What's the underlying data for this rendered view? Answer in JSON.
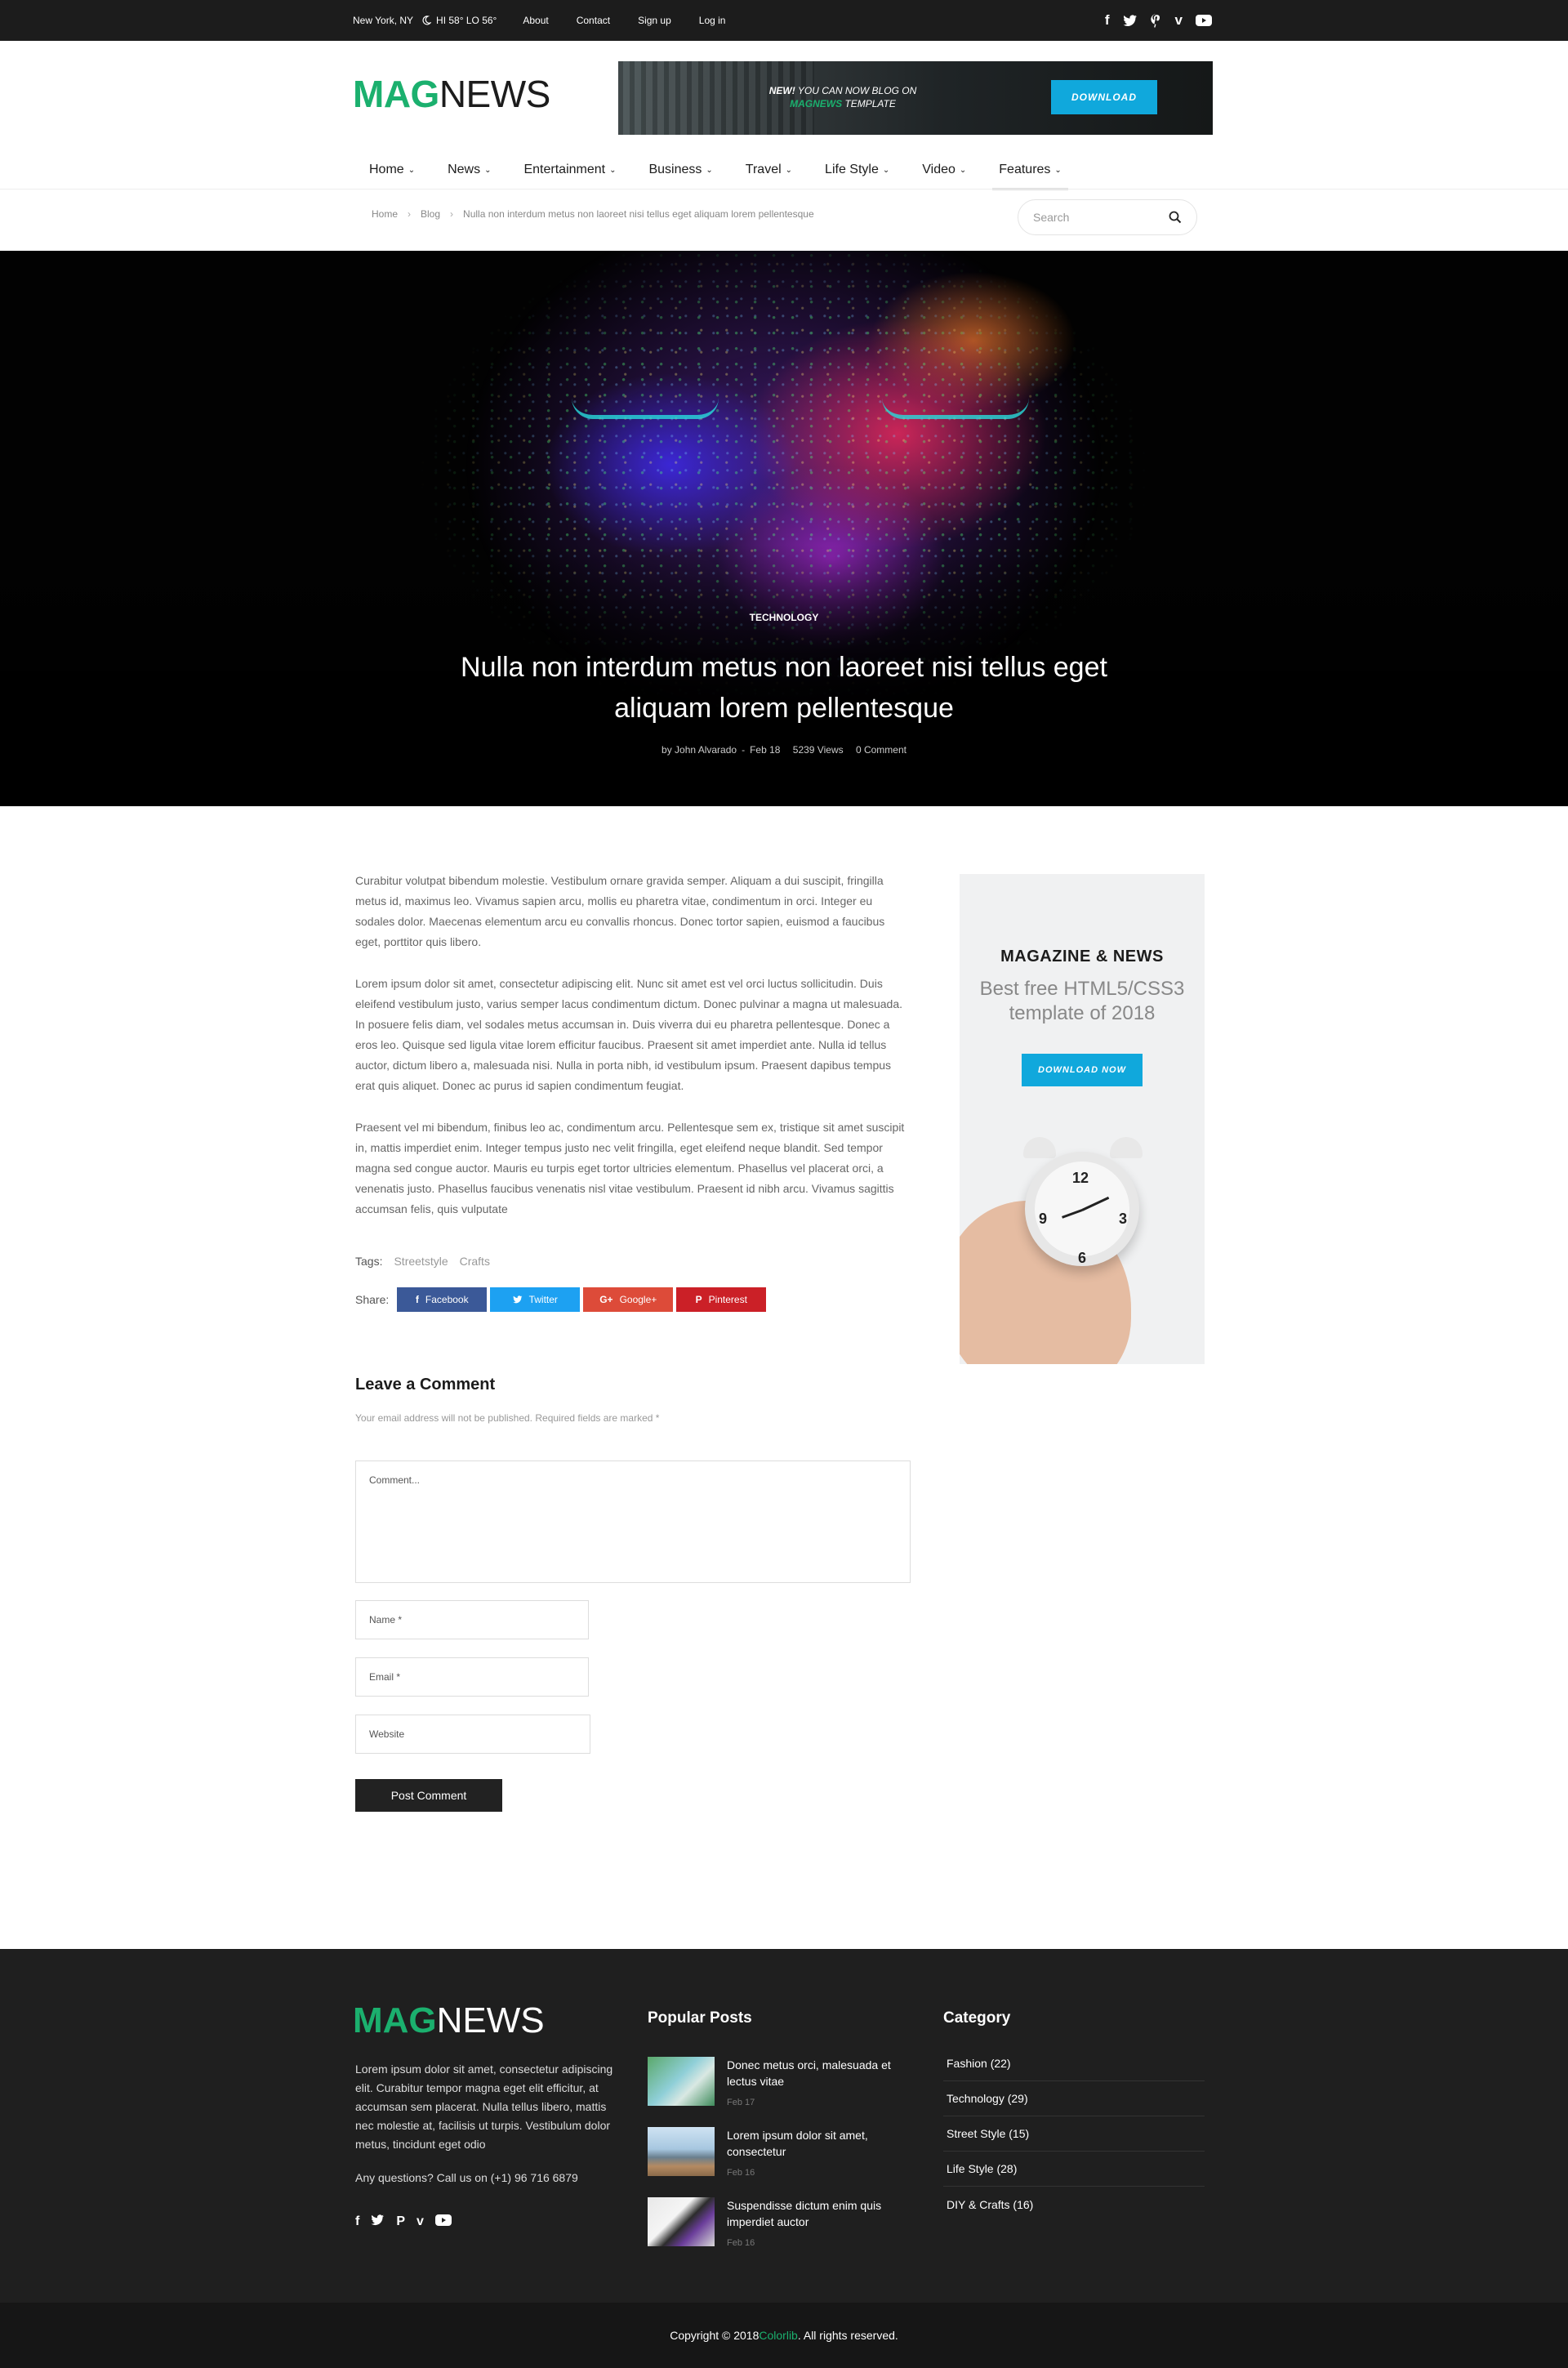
{
  "topbar": {
    "location": "New York, NY",
    "weather": "HI 58° LO 56°",
    "links": [
      "About",
      "Contact",
      "Sign up",
      "Log in"
    ],
    "social_icons": [
      "facebook-icon",
      "twitter-icon",
      "pinterest-icon",
      "vimeo-icon",
      "youtube-icon"
    ]
  },
  "brand": {
    "mag": "MAG",
    "news": "NEWS",
    "accent": "#1bb06e"
  },
  "banner": {
    "line1_bold": "NEW!",
    "line1_rest": " YOU CAN NOW BLOG ON",
    "line2_brand": "MAGNEWS",
    "line2_rest": " TEMPLATE",
    "button": "DOWNLOAD",
    "button_color": "#10a8dc"
  },
  "nav": {
    "items": [
      "Home",
      "News",
      "Entertainment",
      "Business",
      "Travel",
      "Life Style",
      "Video",
      "Features"
    ],
    "active": "Features"
  },
  "breadcrumb": {
    "items": [
      "Home",
      "Blog",
      "Nulla non interdum metus non laoreet nisi tellus eget aliquam lorem pellentesque"
    ]
  },
  "search": {
    "placeholder": "Search"
  },
  "hero": {
    "category": "TECHNOLOGY",
    "title": "Nulla non interdum metus non laoreet nisi tellus eget aliquam lorem pellentesque",
    "author": "by John Alvarado",
    "date": "Feb 18",
    "views": "5239 Views",
    "comments": "0 Comment"
  },
  "article": {
    "paragraphs": [
      "Curabitur volutpat bibendum molestie. Vestibulum ornare gravida semper. Aliquam a dui suscipit, fringilla metus id, maximus leo. Vivamus sapien arcu, mollis eu pharetra vitae, condimentum in orci. Integer eu sodales dolor. Maecenas elementum arcu eu convallis rhoncus. Donec tortor sapien, euismod a faucibus eget, porttitor quis libero.",
      "Lorem ipsum dolor sit amet, consectetur adipiscing elit. Nunc sit amet est vel orci luctus sollicitudin. Duis eleifend vestibulum justo, varius semper lacus condimentum dictum. Donec pulvinar a magna ut malesuada. In posuere felis diam, vel sodales metus accumsan in. Duis viverra dui eu pharetra pellentesque. Donec a eros leo. Quisque sed ligula vitae lorem efficitur faucibus. Praesent sit amet imperdiet ante. Nulla id tellus auctor, dictum libero a, malesuada nisi. Nulla in porta nibh, id vestibulum ipsum. Praesent dapibus tempus erat quis aliquet. Donec ac purus id sapien condimentum feugiat.",
      "Praesent vel mi bibendum, finibus leo ac, condimentum arcu. Pellentesque sem ex, tristique sit amet suscipit in, mattis imperdiet enim. Integer tempus justo nec velit fringilla, eget eleifend neque blandit. Sed tempor magna sed congue auctor. Mauris eu turpis eget tortor ultricies elementum. Phasellus vel placerat orci, a venenatis justo. Phasellus faucibus venenatis nisl vitae vestibulum. Praesent id nibh arcu. Vivamus sagittis accumsan felis, quis vulputate"
    ],
    "tags_label": "Tags:",
    "tags": [
      "Streetstyle",
      "Crafts"
    ],
    "share_label": "Share:",
    "share_buttons": [
      {
        "label": "Facebook",
        "glyph": "f",
        "color": "#3b5998"
      },
      {
        "label": "Twitter",
        "glyph": "🐦",
        "color": "#1da1f2"
      },
      {
        "label": "Google+",
        "glyph": "G+",
        "color": "#dd4b39"
      },
      {
        "label": "Pinterest",
        "glyph": "P",
        "color": "#cb2027"
      }
    ]
  },
  "comment_form": {
    "heading": "Leave a Comment",
    "note": "Your email address will not be published. Required fields are marked *",
    "comment_placeholder": "Comment...",
    "name_placeholder": "Name *",
    "email_placeholder": "Email *",
    "website_placeholder": "Website",
    "submit": "Post Comment"
  },
  "sidebar_ad": {
    "heading": "MAGAZINE & NEWS",
    "subheading": "Best free HTML5/CSS3 template of 2018",
    "button": "DOWNLOAD NOW"
  },
  "footer": {
    "description": "Lorem ipsum dolor sit amet, consectetur adipiscing elit. Curabitur tempor magna eget elit efficitur, at accumsan sem placerat. Nulla tellus libero, mattis nec molestie at, facilisis ut turpis. Vestibulum dolor metus, tincidunt eget odio",
    "contact": "Any questions? Call us on (+1) 96 716 6879",
    "popular_heading": "Popular Posts",
    "popular_posts": [
      {
        "title": "Donec metus orci, malesuada et lectus vitae",
        "date": "Feb 17"
      },
      {
        "title": "Lorem ipsum dolor sit amet, consectetur",
        "date": "Feb 16"
      },
      {
        "title": "Suspendisse dictum enim quis imperdiet auctor",
        "date": "Feb 16"
      }
    ],
    "category_heading": "Category",
    "categories": [
      "Fashion (22)",
      "Technology (29)",
      "Street Style (15)",
      "Life Style (28)",
      "DIY & Crafts (16)"
    ],
    "copyright_pre": "Copyright © 2018 ",
    "copyright_brand": "Colorlib",
    "copyright_post": ". All rights reserved."
  }
}
